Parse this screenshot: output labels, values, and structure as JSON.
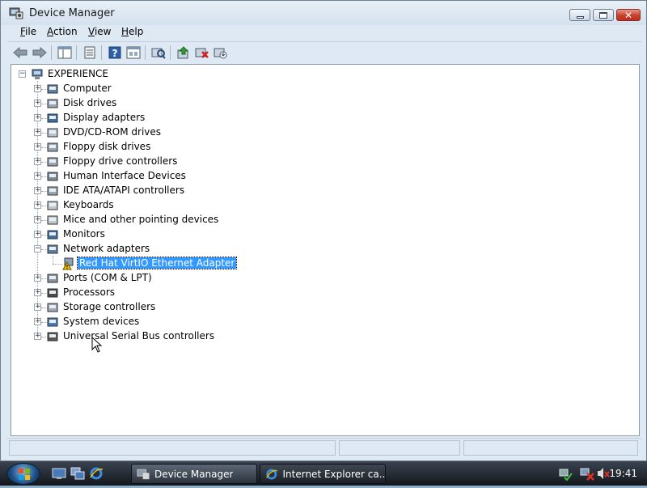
{
  "window": {
    "title": "Device Manager",
    "menu": [
      "File",
      "Action",
      "View",
      "Help"
    ],
    "menu_accel": [
      "F",
      "A",
      "V",
      "H"
    ]
  },
  "toolbar": {
    "buttons": [
      "back-icon",
      "forward-icon",
      "show-hide-console-tree-icon",
      "properties-icon",
      "help-icon",
      "properties-view-icon",
      "scan-hardware-icon",
      "update-driver-icon",
      "uninstall-icon",
      "disable-icon"
    ]
  },
  "tree": {
    "root": "EXPERIENCE",
    "categories": [
      "Computer",
      "Disk drives",
      "Display adapters",
      "DVD/CD-ROM drives",
      "Floppy disk drives",
      "Floppy drive controllers",
      "Human Interface Devices",
      "IDE ATA/ATAPI controllers",
      "Keyboards",
      "Mice and other pointing devices",
      "Monitors",
      "Network adapters",
      "Ports (COM & LPT)",
      "Processors",
      "Storage controllers",
      "System devices",
      "Universal Serial Bus controllers"
    ],
    "network_child": "Red Hat VirtIO Ethernet Adapter",
    "expanded_category": "Network adapters",
    "selected_item": "Red Hat VirtIO Ethernet Adapter"
  },
  "taskbar": {
    "tasks": [
      "Device Manager",
      "Internet Explorer ca..."
    ],
    "clock": "19:41"
  },
  "colors": {
    "selection": "#3399ff",
    "warning": "#f3c400",
    "close_button": "#c8402c"
  }
}
